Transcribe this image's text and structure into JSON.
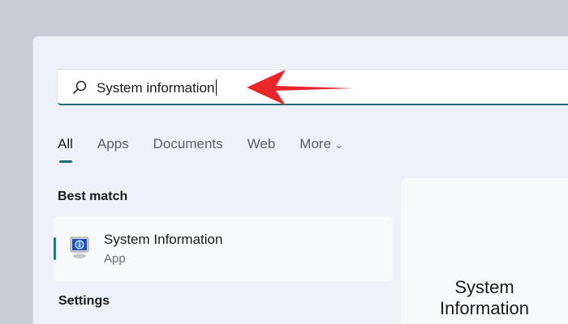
{
  "search": {
    "value": "System information",
    "icon": "search-icon"
  },
  "tabs": [
    {
      "label": "All",
      "active": true
    },
    {
      "label": "Apps"
    },
    {
      "label": "Documents"
    },
    {
      "label": "Web"
    },
    {
      "label": "More"
    }
  ],
  "best_match": {
    "heading": "Best match",
    "item": {
      "title": "System Information",
      "subtitle": "App",
      "icon": "system-information-icon"
    }
  },
  "settings_heading": "Settings",
  "preview": {
    "title": "System Information"
  },
  "colors": {
    "accent": "#1f6b7a",
    "arrow": "#e8262b"
  }
}
